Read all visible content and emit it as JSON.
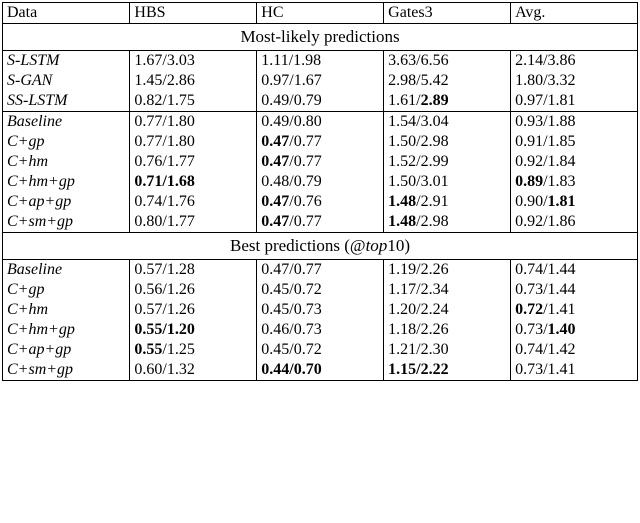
{
  "chart_data": {
    "type": "table",
    "title": "",
    "columns": [
      "Data",
      "HBS",
      "HC",
      "Gates3",
      "Avg."
    ],
    "sections": [
      {
        "name": "Most-likely predictions",
        "groups": [
          [
            {
              "data": "S-LSTM",
              "hbs": "1.67/3.03",
              "hc": "1.11/1.98",
              "g": "3.63/6.56",
              "avg": "2.14/3.86"
            },
            {
              "data": "S-GAN",
              "hbs": "1.45/2.86",
              "hc": "0.97/1.67",
              "g": "2.98/5.42",
              "avg": "1.80/3.32"
            },
            {
              "data": "SS-LSTM",
              "hbs": "0.82/1.75",
              "hc": "0.49/0.79",
              "g": "1.61/<b>2.89</b>",
              "avg": "0.97/1.81"
            }
          ],
          [
            {
              "data": "Baseline",
              "hbs": "0.77/1.80",
              "hc": "0.49/0.80",
              "g": "1.54/3.04",
              "avg": "0.93/1.88"
            },
            {
              "data": "C+gp",
              "hbs": "0.77/1.80",
              "hc": "<b>0.47</b>/0.77",
              "g": "1.50/2.98",
              "avg": "0.91/1.85"
            },
            {
              "data": "C+hm",
              "hbs": "0.76/1.77",
              "hc": "<b>0.47</b>/0.77",
              "g": "1.52/2.99",
              "avg": "0.92/1.84"
            },
            {
              "data": "C+hm+gp",
              "hbs": "<b>0.71/1.68</b>",
              "hc": "0.48/0.79",
              "g": "1.50/3.01",
              "avg": "<b>0.89</b>/1.83"
            },
            {
              "data": "C+ap+gp",
              "hbs": "0.74/1.76",
              "hc": "<b>0.47</b>/0.76",
              "g": "<b>1.48</b>/2.91",
              "avg": "0.90/<b>1.81</b>"
            },
            {
              "data": "C+sm+gp",
              "hbs": "0.80/1.77",
              "hc": "<b>0.47</b>/0.77",
              "g": "<b>1.48</b>/2.98",
              "avg": "0.92/1.86"
            }
          ]
        ]
      },
      {
        "name": "Best predictions (@<i>top</i>10)",
        "groups": [
          [
            {
              "data": "Baseline",
              "hbs": "0.57/1.28",
              "hc": "0.47/0.77",
              "g": "1.19/2.26",
              "avg": "0.74/1.44"
            },
            {
              "data": "C+gp",
              "hbs": "0.56/1.26",
              "hc": "0.45/0.72",
              "g": "1.17/2.34",
              "avg": "0.73/1.44"
            },
            {
              "data": "C+hm",
              "hbs": "0.57/1.26",
              "hc": "0.45/0.73",
              "g": "1.20/2.24",
              "avg": "<b>0.72</b>/1.41"
            },
            {
              "data": "C+hm+gp",
              "hbs": "<b>0.55/1.20</b>",
              "hc": "0.46/0.73",
              "g": "1.18/2.26",
              "avg": "0.73/<b>1.40</b>"
            },
            {
              "data": "C+ap+gp",
              "hbs": "<b>0.55</b>/1.25",
              "hc": "0.45/0.72",
              "g": "1.21/2.30",
              "avg": "0.74/1.42"
            },
            {
              "data": "C+sm+gp",
              "hbs": "0.60/1.32",
              "hc": "<b>0.44/0.70</b>",
              "g": "<b>1.15/2.22</b>",
              "avg": "0.73/1.41"
            }
          ]
        ]
      }
    ]
  },
  "header": {
    "c0": "Data",
    "c1": "HBS",
    "c2": "HC",
    "c3": "Gates3",
    "c4": "Avg."
  }
}
